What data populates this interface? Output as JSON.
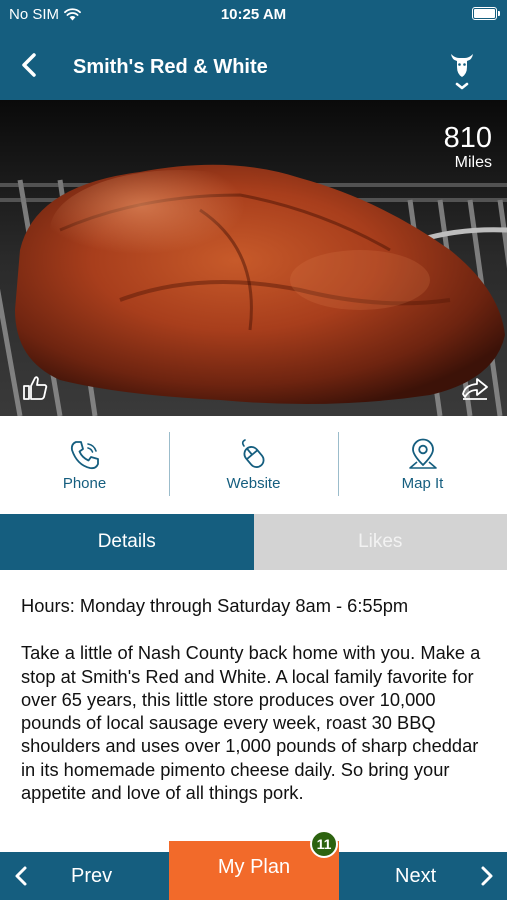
{
  "status_bar": {
    "carrier": "No SIM",
    "time": "10:25 AM"
  },
  "nav": {
    "title": "Smith's Red & White"
  },
  "hero": {
    "distance_value": "810",
    "distance_unit": "Miles"
  },
  "actions": [
    {
      "label": "Phone",
      "icon": "phone-icon"
    },
    {
      "label": "Website",
      "icon": "mouse-icon"
    },
    {
      "label": "Map It",
      "icon": "map-pin-icon"
    }
  ],
  "tabs": [
    {
      "label": "Details",
      "active": true
    },
    {
      "label": "Likes",
      "active": false
    }
  ],
  "content": {
    "hours": "Hours: Monday through Saturday 8am - 6:55pm",
    "description": "Take a little of Nash County back home with you. Make a stop at Smith's Red and White. A local family favorite for over 65 years, this little store produces over 10,000 pounds of local sausage every week, roast 30 BBQ shoulders and uses over 1,000 pounds of sharp cheddar in its homemade pimento cheese daily. So bring your appetite and love of all things pork."
  },
  "bottom": {
    "prev_label": "Prev",
    "next_label": "Next",
    "plan_label": "My Plan",
    "plan_count": "11"
  },
  "colors": {
    "primary": "#155e7f",
    "accent": "#f26a2a",
    "badge": "#2d6310",
    "tab_inactive": "#d3d3d3"
  }
}
